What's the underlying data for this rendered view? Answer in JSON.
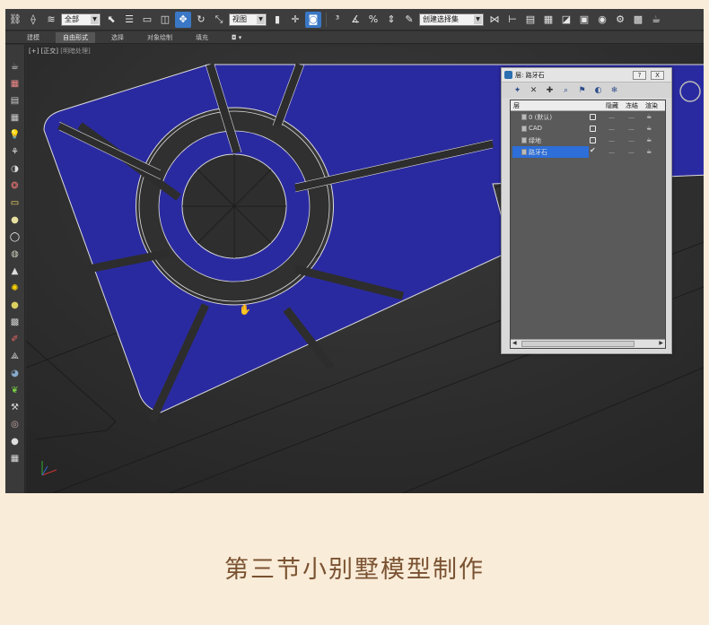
{
  "toolbar": {
    "selection_filter": "全部",
    "reference_coord": "视图",
    "named_selection": "创建选择集",
    "icons": [
      "link-icon",
      "unlink-icon",
      "bind-space-warp-icon",
      "select-object-icon",
      "select-by-name-icon",
      "rectangular-selection-icon",
      "window-crossing-icon",
      "move-icon",
      "rotate-icon",
      "scale-icon",
      "pivot-icon",
      "select-manipulate-icon",
      "snap-3d-icon",
      "angle-snap-icon",
      "percent-snap-icon",
      "spinner-snap-icon",
      "edit-named-selection-icon",
      "mirror-icon",
      "align-icon",
      "layer-manager-icon",
      "graphite-tools-icon",
      "curve-editor-icon",
      "schematic-view-icon",
      "material-editor-icon",
      "render-setup-icon",
      "rendered-frame-icon",
      "render-icon"
    ]
  },
  "ribbon": {
    "tabs": [
      "建模",
      "自由形式",
      "选择",
      "对象绘制",
      "填充"
    ]
  },
  "left_toolbar": {
    "icons": [
      "teapot-icon",
      "layer-icon",
      "panel-icon",
      "grid-icon",
      "light-icon",
      "hierarchy-icon",
      "motion-icon",
      "display-icon",
      "box-icon",
      "sphere-icon",
      "ring-icon",
      "torus-icon",
      "cone-icon",
      "sun-icon",
      "pattern-icon",
      "checker-icon",
      "paint-icon",
      "gizmo-icon",
      "globe-icon",
      "plant-icon",
      "bones-icon",
      "ball-icon",
      "sphere-shaded-icon",
      "grid-panel-icon"
    ]
  },
  "viewport": {
    "label_plus": "[+]",
    "label_view": "[正交]",
    "label_mode": "[明暗处理]",
    "fill_color": "#2a2aa0",
    "outline_color": "#d9d9d9",
    "background_color": "#2b2b2b"
  },
  "layer_dialog": {
    "title": "层: 路牙石",
    "help_button": "?",
    "close_button": "X",
    "columns": {
      "layer": "层",
      "hide": "隐藏",
      "freeze": "冻结",
      "render": "渲染"
    },
    "rows": [
      {
        "name": "0 (默认)",
        "state": "box",
        "freeze": "—",
        "render_dash": "—"
      },
      {
        "name": "CAD",
        "state": "box",
        "freeze": "—",
        "render_dash": "—"
      },
      {
        "name": "绿地",
        "state": "box",
        "freeze": "—",
        "render_dash": "—"
      },
      {
        "name": "路牙石",
        "state": "check",
        "freeze": "—",
        "render_dash": "—",
        "selected": true
      }
    ]
  },
  "caption": "第三节小别墅模型制作"
}
